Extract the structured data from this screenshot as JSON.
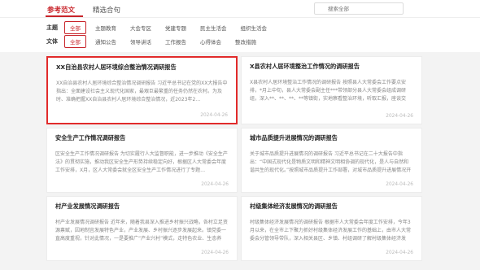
{
  "tabs": [
    {
      "label": "参考范文",
      "active": true
    },
    {
      "label": "精选合句",
      "active": false
    }
  ],
  "search": {
    "placeholder": "搜索全部"
  },
  "filters": {
    "theme": {
      "label": "主题",
      "options": [
        "全部",
        "主题教育",
        "大会专区",
        "党建专题",
        "民主生活会",
        "组织生活会"
      ],
      "selected": "全部"
    },
    "genre": {
      "label": "文体",
      "options": [
        "全部",
        "通知公告",
        "领导讲话",
        "工作报告",
        "心得体会",
        "整改措施"
      ],
      "selected": "全部"
    }
  },
  "cards": [
    {
      "title": "XX自治县农村人居环境综合整治情况调研报告",
      "body": "XX自治县农村人居环境综合整治情况调研报告 习近平总书记在党的XX大报告中指出：全面建设社会主义现代化国家，最艰巨最繁重的任务仍然在农村。为及时、准确把握XX自治县农村人居环境综合整治情况，近2023年2…",
      "date": "2024-04-26",
      "highlighted": true
    },
    {
      "title": "X县农村人居环境整治工作情况的调研报告",
      "body": "X县农村人居环境整治工作情况的调研报告 按照县人大常委会工作要点安排，*月上中旬，县人大常委会副主任***带领部分县人大常委会组成调研组，深入**、**、**、**等镇街，实地察看整治环境，听取汇报，座谈交流…",
      "date": "2024-04-26",
      "highlighted": false
    },
    {
      "title": "安全生产工作情况调研报告",
      "body": "区安全生产工作情况调研报告 为切实履行人大监督职能，进一步推动《安全生产法》的贯彻实施，推动我区安全生产形势持续稳定向好，根据区人大常委会年度工作安排，X月，区人大常委会就全区安全生产工作情况进行了专题…",
      "date": "2024-04-26",
      "highlighted": false
    },
    {
      "title": "城市品质提升进展情况的调研报告",
      "body": "关于城市品质提升进展情况的调研报告 习近平总书记在二十大报告中指出：“中国式现代化是物质文明和精神文明相协调的现代化，是人与自然和谐共生的现代化。”按照城市品质提升工作部署，对城市品质提升进展情况开展…",
      "date": "2024-04-26",
      "highlighted": false
    },
    {
      "title": "村产业发展情况调研报告",
      "body": "村产业发展情况调研报告 近年来，随着我县深入推进乡村振兴战略，各村立足资源禀赋，因地制宜发展特色产业，产业发展、乡村振兴逐步发展起来。镇党委一直高度重视，针对此情况，一是要推广“产业兴村”模式，走特色农业、生态养殖、乡村旅游、生态旅游…",
      "date": "2024-04-26",
      "highlighted": false
    },
    {
      "title": "村级集体经济发展情况的调研报告",
      "body": "村级集体经济发展情况的调研报告 根据市人大常委会年度工作安排，今年3月以来，在全市上下聚力抓好村级集体经济发展工作的基础上，由市人大常委会分管领导带队，深入相关县区、乡镇、村组调研了解村级集体经济发展…",
      "date": "2024-04-26",
      "highlighted": false
    }
  ]
}
